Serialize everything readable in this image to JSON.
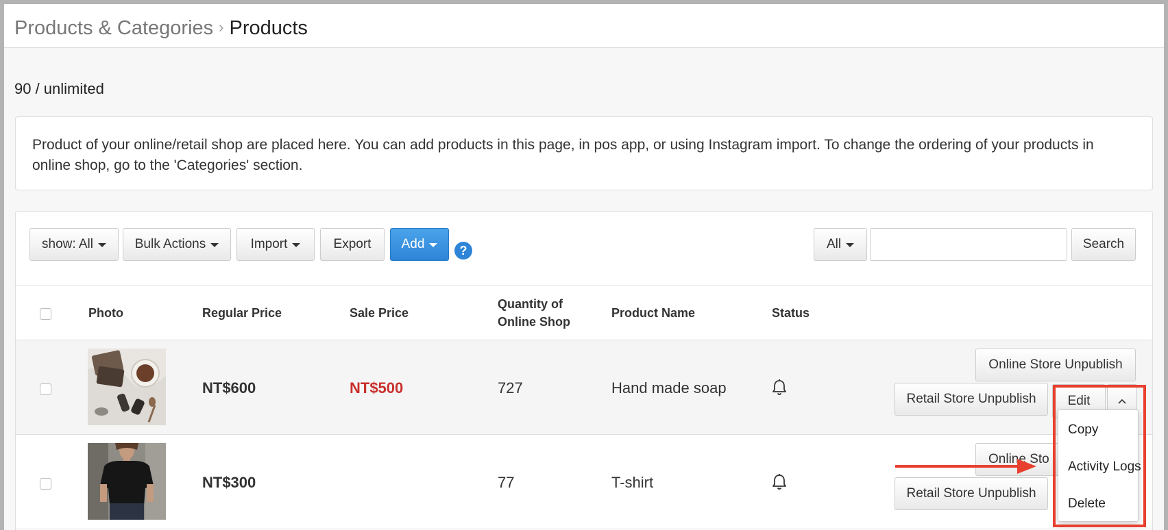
{
  "breadcrumb": {
    "parent": "Products & Categories",
    "current": "Products"
  },
  "quota": "90 / unlimited",
  "info_text": "Product of your online/retail shop are placed here. You can add products in this page, in pos app, or using Instagram import. To change the ordering of your products in online shop, go to the 'Categories' section.",
  "toolbar": {
    "show_label": "show: All",
    "bulk_label": "Bulk Actions",
    "import_label": "Import",
    "export_label": "Export",
    "add_label": "Add",
    "help_glyph": "?",
    "filter_label": "All",
    "search_label": "Search",
    "search_value": ""
  },
  "table": {
    "headers": {
      "photo": "Photo",
      "regular_price": "Regular Price",
      "sale_price": "Sale Price",
      "quantity_line1": "Quantity of",
      "quantity_line2": "Online Shop",
      "product_name": "Product Name",
      "status": "Status"
    },
    "rows": [
      {
        "regular_price": "NT$600",
        "sale_price": "NT$500",
        "quantity": "727",
        "name": "Hand made soap",
        "online_btn": "Online Store Unpublish",
        "retail_btn": "Retail Store Unpublish",
        "edit_btn": "Edit"
      },
      {
        "regular_price": "NT$300",
        "sale_price": "",
        "quantity": "77",
        "name": "T-shirt",
        "online_btn": "Online Sto",
        "retail_btn": "Retail Store Unpublish"
      }
    ]
  },
  "dropdown": {
    "items": [
      "Copy",
      "Activity Logs",
      "Delete"
    ]
  },
  "colors": {
    "accent": "#2e85d8",
    "sale": "#c9302c",
    "highlight": "#e8402f"
  }
}
